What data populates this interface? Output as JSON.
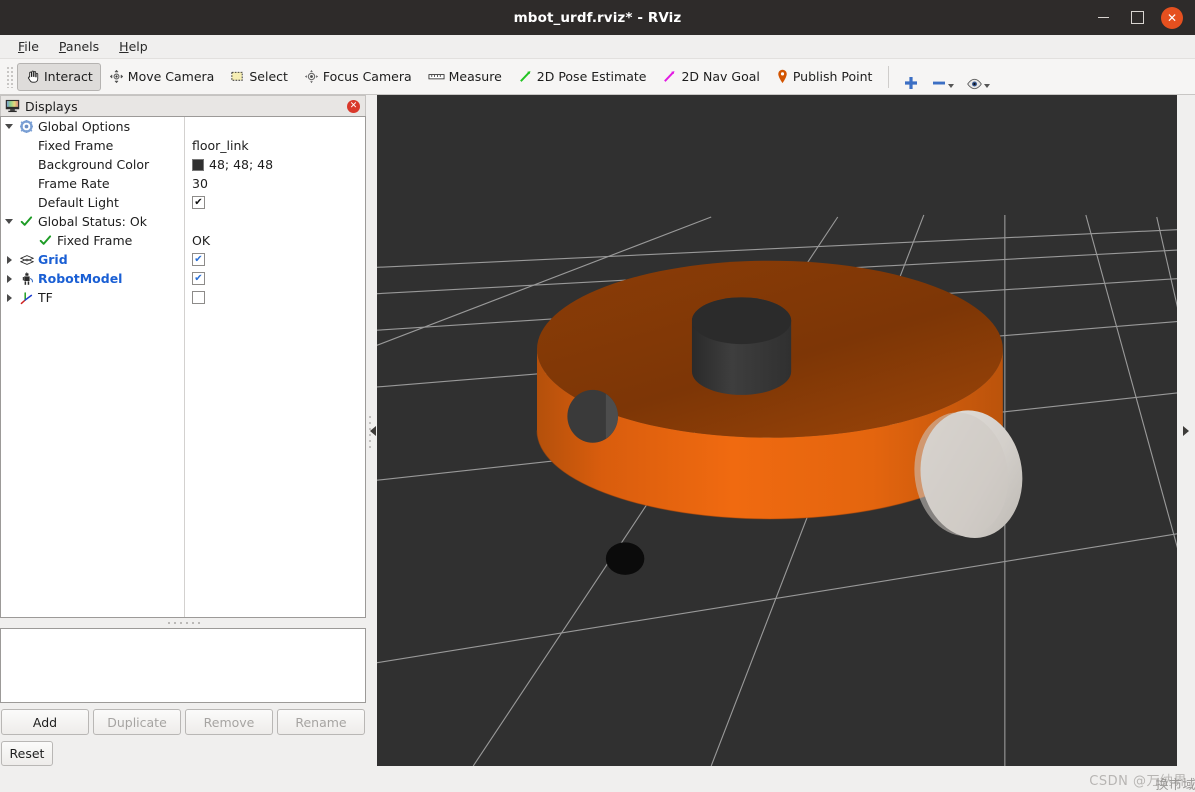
{
  "window": {
    "title": "mbot_urdf.rviz* - RViz",
    "minimize_label": "",
    "maximize_label": "",
    "close_label": "✕"
  },
  "menubar": {
    "items": [
      {
        "label": "File",
        "mnemonic": "F"
      },
      {
        "label": "Panels",
        "mnemonic": "P"
      },
      {
        "label": "Help",
        "mnemonic": "H"
      }
    ]
  },
  "toolbar": {
    "tools": [
      {
        "label": "Interact",
        "icon": "hand-cursor-icon",
        "active": true
      },
      {
        "label": "Move Camera",
        "icon": "move-camera-icon",
        "active": false
      },
      {
        "label": "Select",
        "icon": "select-rectangle-icon",
        "active": false
      },
      {
        "label": "Focus Camera",
        "icon": "focus-camera-icon",
        "active": false
      },
      {
        "label": "Measure",
        "icon": "ruler-icon",
        "active": false
      },
      {
        "label": "2D Pose Estimate",
        "icon": "green-arrow-icon",
        "active": false
      },
      {
        "label": "2D Nav Goal",
        "icon": "magenta-arrow-icon",
        "active": false
      },
      {
        "label": "Publish Point",
        "icon": "map-pin-icon",
        "active": false
      }
    ],
    "icon_buttons": [
      {
        "name": "add-tool-icon",
        "glyph": "+"
      },
      {
        "name": "remove-tool-icon",
        "glyph": "−"
      },
      {
        "name": "visibility-eye-icon",
        "glyph": "eye"
      }
    ]
  },
  "displays_panel": {
    "title": "Displays",
    "header_icon": "monitor-icon",
    "close_label": "✕",
    "tree": [
      {
        "label": "Global Options",
        "icon": "gear-icon",
        "expander": "down",
        "indent": 0,
        "style": "plain",
        "value_type": "none",
        "value": ""
      },
      {
        "label": "Fixed Frame",
        "icon": "none",
        "expander": "none",
        "indent": 1,
        "style": "plain",
        "value_type": "text",
        "value": "floor_link"
      },
      {
        "label": "Background Color",
        "icon": "none",
        "expander": "none",
        "indent": 1,
        "style": "plain",
        "value_type": "color",
        "value": "48; 48; 48",
        "swatch": "#303030"
      },
      {
        "label": "Frame Rate",
        "icon": "none",
        "expander": "none",
        "indent": 1,
        "style": "plain",
        "value_type": "text",
        "value": "30"
      },
      {
        "label": "Default Light",
        "icon": "none",
        "expander": "none",
        "indent": 1,
        "style": "plain",
        "value_type": "checkbox-black",
        "value": ""
      },
      {
        "label": "Global Status: Ok",
        "icon": "green-check-icon",
        "expander": "down",
        "indent": 0,
        "style": "plain",
        "value_type": "none",
        "value": ""
      },
      {
        "label": "Fixed Frame",
        "icon": "green-check-icon",
        "expander": "none",
        "indent": 1,
        "style": "plain",
        "value_type": "text",
        "value": "OK"
      },
      {
        "label": "Grid",
        "icon": "grid-icon",
        "expander": "right",
        "indent": 0,
        "style": "blue",
        "value_type": "checkbox-blue",
        "value": ""
      },
      {
        "label": "RobotModel",
        "icon": "robot-icon",
        "expander": "right",
        "indent": 0,
        "style": "blue",
        "value_type": "checkbox-blue",
        "value": ""
      },
      {
        "label": "TF",
        "icon": "tf-axes-icon",
        "expander": "right",
        "indent": 0,
        "style": "plain",
        "value_type": "checkbox-off",
        "value": ""
      }
    ]
  },
  "bottom_buttons": [
    {
      "label": "Add",
      "enabled": true
    },
    {
      "label": "Duplicate",
      "enabled": false
    },
    {
      "label": "Remove",
      "enabled": false
    },
    {
      "label": "Rename",
      "enabled": false
    }
  ],
  "reset_button": {
    "label": "Reset",
    "enabled": true
  },
  "viewport": {
    "background_color": "#303030",
    "grid_line_color": "#b0b0b0",
    "robot": {
      "body_color": "#e4650e",
      "body_top_color": "#8a3c07",
      "body_shade_color": "#c4560c",
      "lidar_color": "#3a3a3a",
      "lidar_top_color": "#2b2b2b",
      "wheel_color": "#d8d4cf",
      "wheel_shade_color": "#b9b5b0",
      "camera_hole_color": "#3a3a3a",
      "caster_color": "#0b0b0b"
    }
  },
  "splitters": {
    "left_collapse_icon": "arrow-left-icon",
    "right_collapse_icon": "arrow-right-icon"
  },
  "statusbar": {
    "watermark_prefix": "CSDN @",
    "watermark_cjk": "万纳界",
    "watermark_cjk_overlay": "换市域"
  }
}
